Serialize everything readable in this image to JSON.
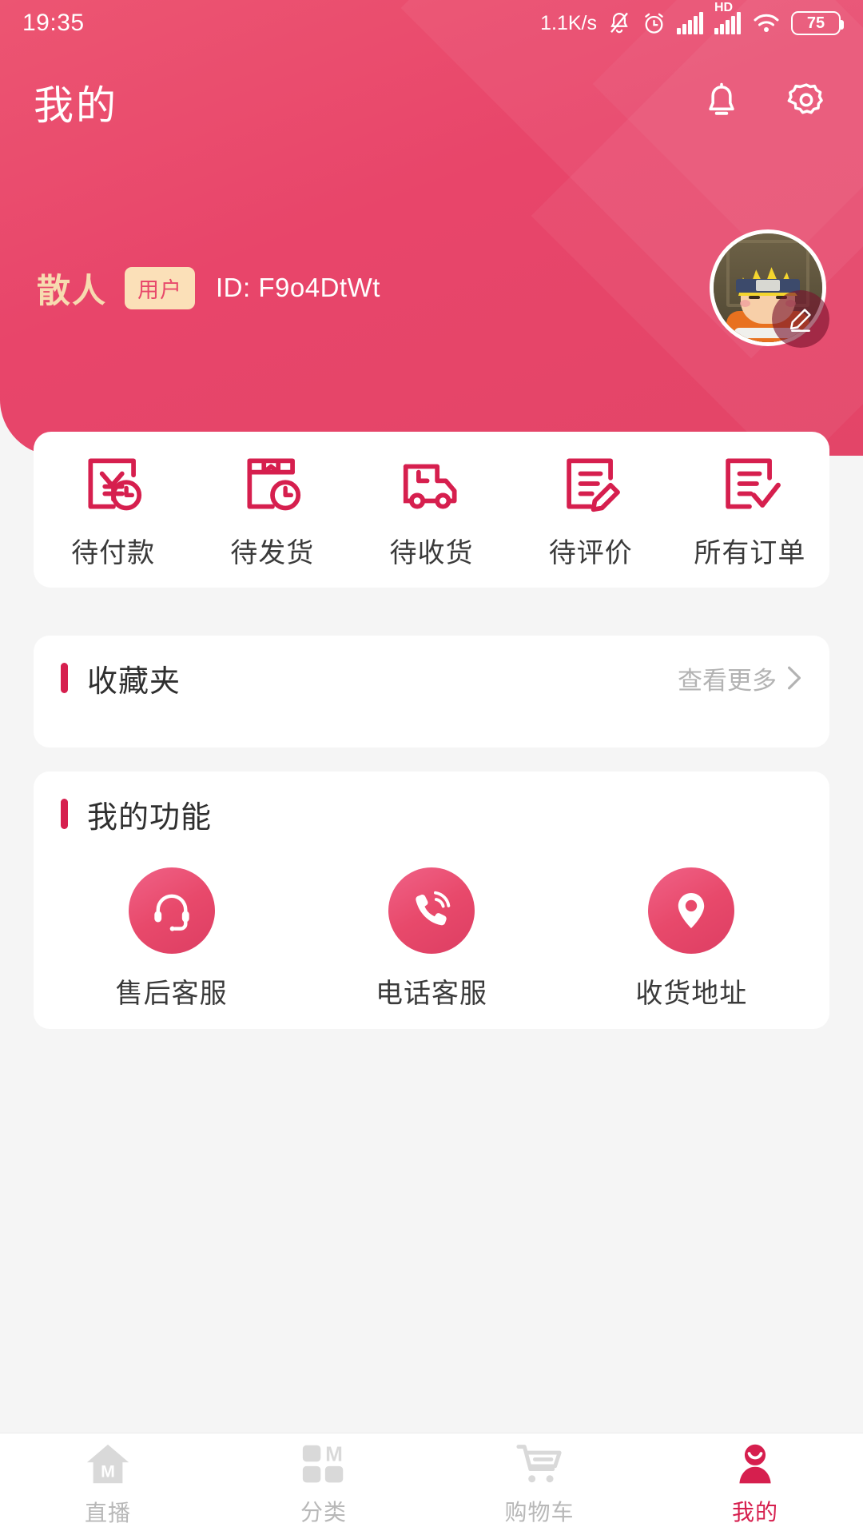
{
  "status_bar": {
    "time": "19:35",
    "network_speed": "1.1K/s",
    "hd_label": "HD",
    "battery_level": "75",
    "icons": [
      "mute-bell-icon",
      "alarm-clock-icon",
      "signal-bars-icon",
      "hd-signal-icon",
      "wifi-icon",
      "battery-icon"
    ]
  },
  "header": {
    "title": "我的",
    "notification_icon": "bell-icon",
    "settings_icon": "gear-icon",
    "background_color": "#e8496b"
  },
  "profile": {
    "username": "散人",
    "badge": "用户",
    "user_id": "ID: F9o4DtWt",
    "avatar_alt": "anime-character-avatar",
    "edit_icon": "pencil-icon"
  },
  "orders": [
    {
      "label": "待付款",
      "icon": "payment-pending-icon"
    },
    {
      "label": "待发货",
      "icon": "package-pending-icon"
    },
    {
      "label": "待收货",
      "icon": "delivery-truck-icon"
    },
    {
      "label": "待评价",
      "icon": "review-pencil-icon"
    },
    {
      "label": "所有订单",
      "icon": "order-check-icon"
    }
  ],
  "favorites": {
    "title": "收藏夹",
    "more_label": "查看更多",
    "chevron_icon": "chevron-right-icon"
  },
  "functions": {
    "title": "我的功能",
    "items": [
      {
        "label": "售后客服",
        "icon": "headset-icon"
      },
      {
        "label": "电话客服",
        "icon": "phone-call-icon"
      },
      {
        "label": "收货地址",
        "icon": "map-pin-icon"
      }
    ]
  },
  "bottom_nav": {
    "items": [
      {
        "label": "直播",
        "icon": "home-live-icon",
        "active": false
      },
      {
        "label": "分类",
        "icon": "grid-category-icon",
        "active": false
      },
      {
        "label": "购物车",
        "icon": "shopping-cart-icon",
        "active": false
      },
      {
        "label": "我的",
        "icon": "user-profile-icon",
        "active": true
      }
    ],
    "active_color": "#d61f4e",
    "inactive_color": "#b8b8b8"
  },
  "theme": {
    "primary": "#e8496b",
    "accent": "#d61f4e",
    "page_background": "#f5f5f5",
    "badge_background": "#fbe0b8",
    "username_color": "#f7dbb0"
  }
}
